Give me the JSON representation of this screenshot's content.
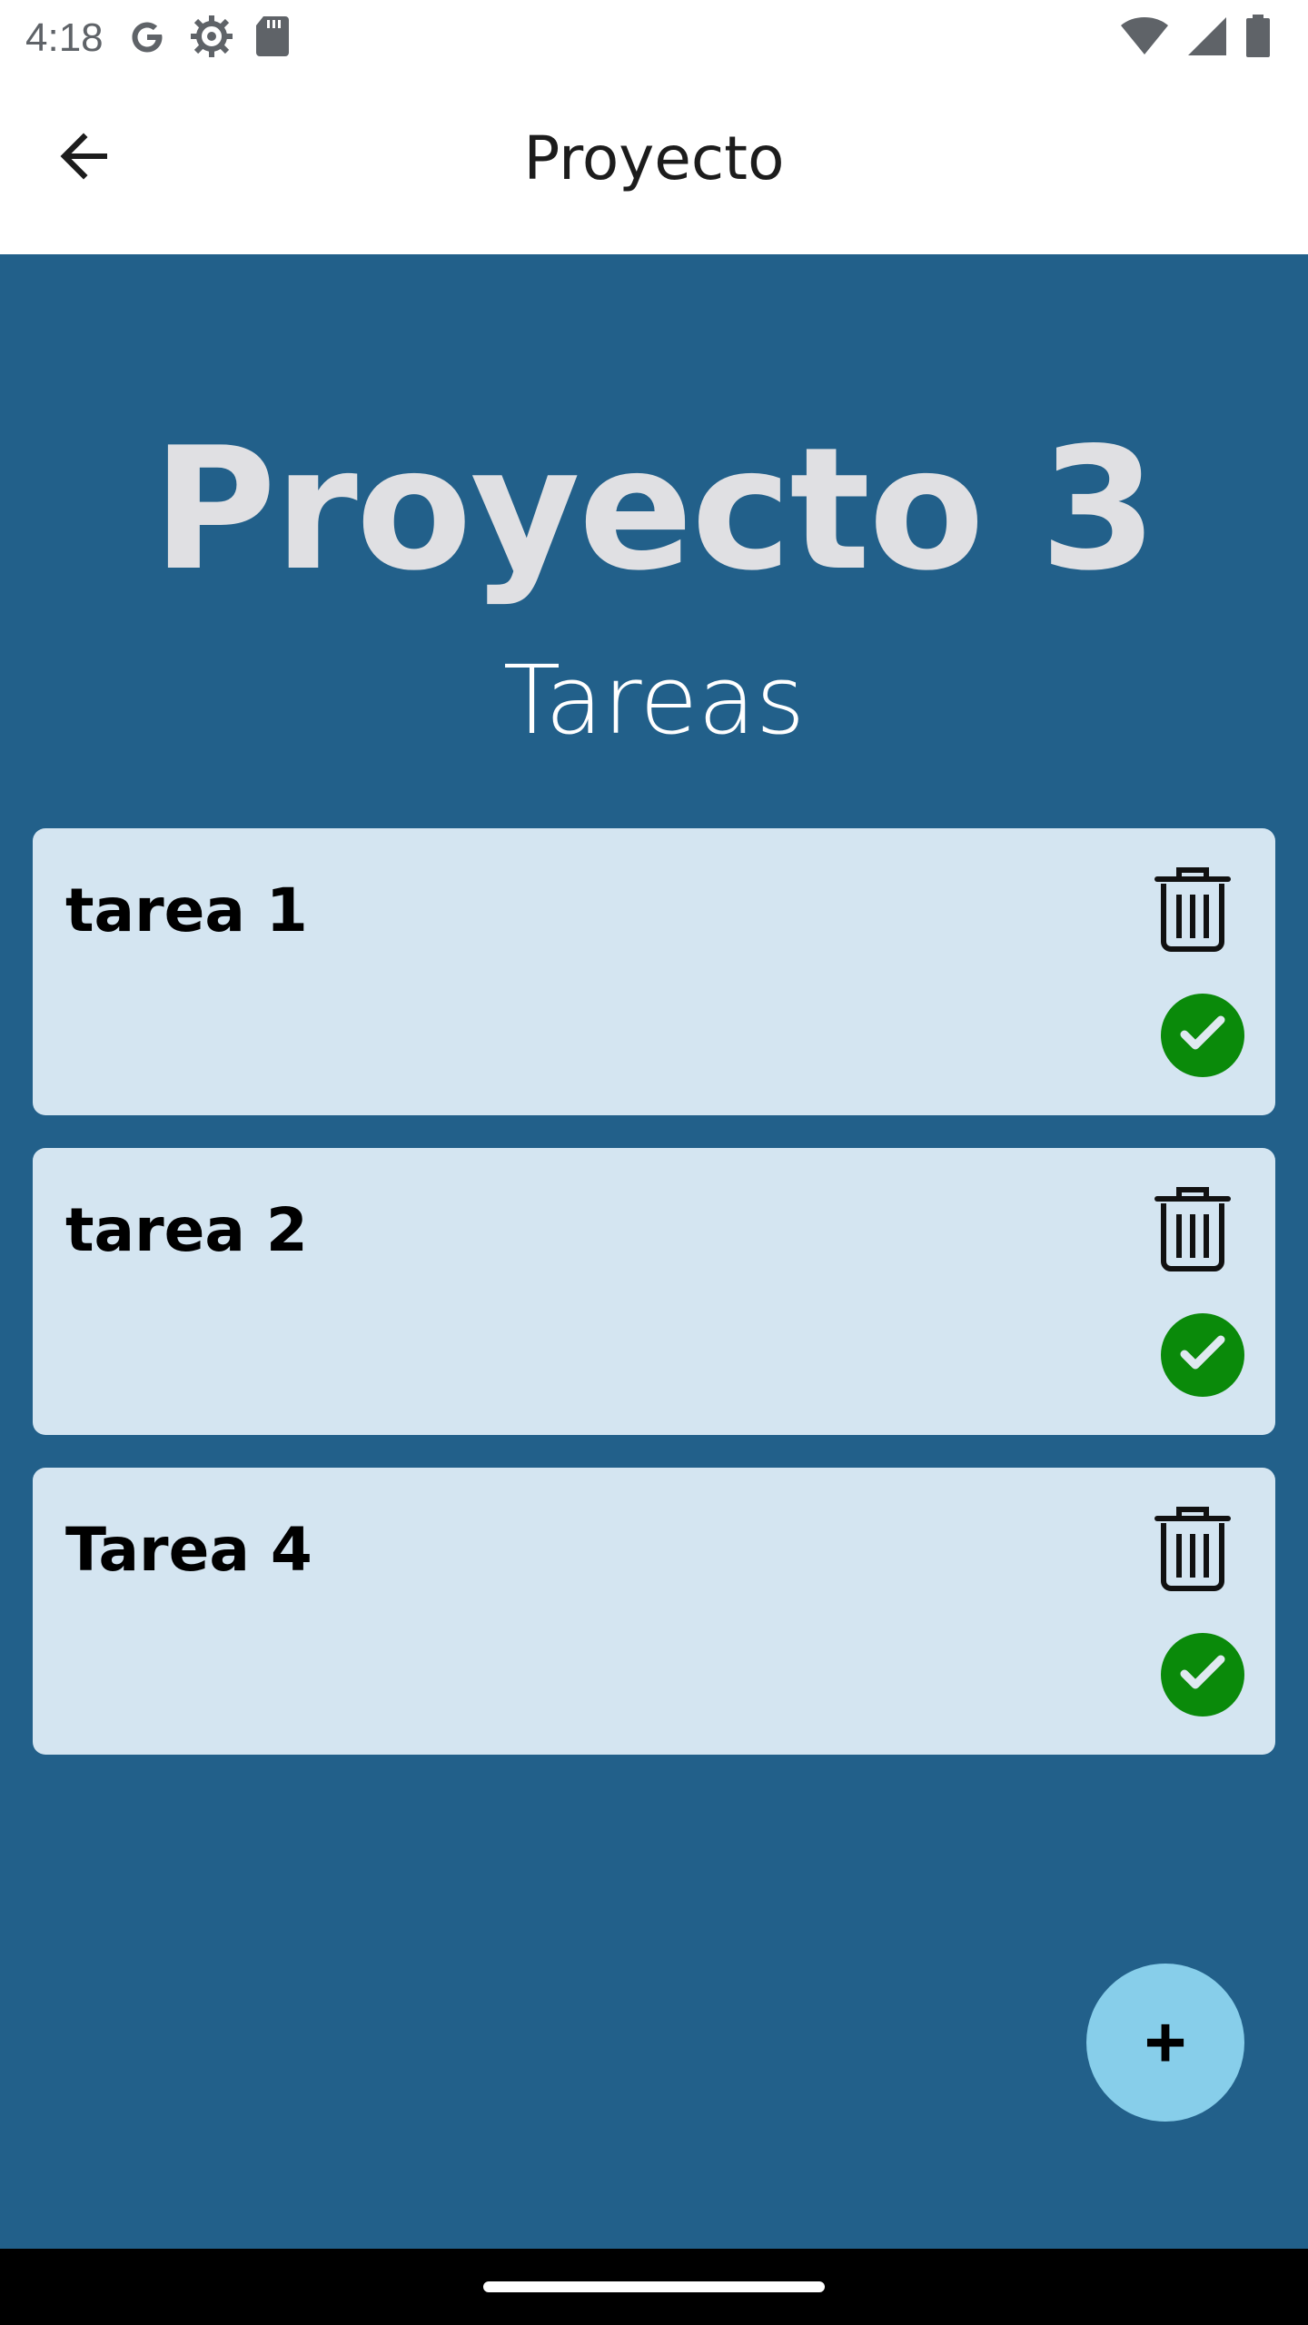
{
  "status_bar": {
    "time": "4:18",
    "left_icons": [
      "google-icon",
      "settings-gear-icon",
      "sd-card-icon"
    ],
    "right_icons": [
      "wifi-icon",
      "signal-icon",
      "battery-icon"
    ]
  },
  "app_bar": {
    "title": "Proyecto",
    "back_icon": "arrow-back-icon"
  },
  "main": {
    "project_title": "Proyecto 3",
    "section_title": "Tareas",
    "tasks": [
      {
        "label": "tarea 1"
      },
      {
        "label": "tarea 2"
      },
      {
        "label": "Tarea 4"
      }
    ],
    "fab_label": "+"
  },
  "colors": {
    "background": "#22608a",
    "card": "#d4e5f1",
    "complete": "#0a8a0a",
    "fab": "#87ceea"
  }
}
